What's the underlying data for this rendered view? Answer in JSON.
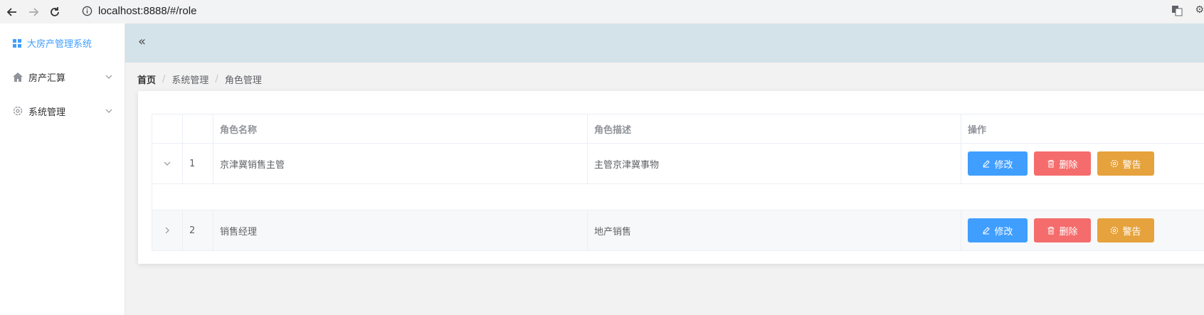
{
  "browser": {
    "url": "localhost:8888/#/role"
  },
  "sidebar": {
    "brand": "大房产管理系统",
    "items": [
      {
        "label": "房产汇算",
        "icon": "home-icon"
      },
      {
        "label": "系统管理",
        "icon": "gear-icon"
      }
    ]
  },
  "header": {
    "collapse_symbol": "«"
  },
  "breadcrumb": {
    "items": [
      "首页",
      "系统管理",
      "角色管理"
    ],
    "separator": "/"
  },
  "table": {
    "columns": [
      "",
      "",
      "角色名称",
      "角色描述",
      "操作"
    ],
    "rows": [
      {
        "index": "1",
        "name": "京津冀销售主管",
        "description": "主管京津冀事物",
        "expanded": true
      },
      {
        "index": "2",
        "name": "销售经理",
        "description": "地产销售",
        "expanded": false
      }
    ],
    "actions": {
      "edit": "修改",
      "delete": "删除",
      "warn": "警告"
    }
  },
  "colors": {
    "primary": "#409eff",
    "danger": "#f56c6c",
    "warning": "#e6a23c",
    "header_bg": "#d4e2ea"
  }
}
